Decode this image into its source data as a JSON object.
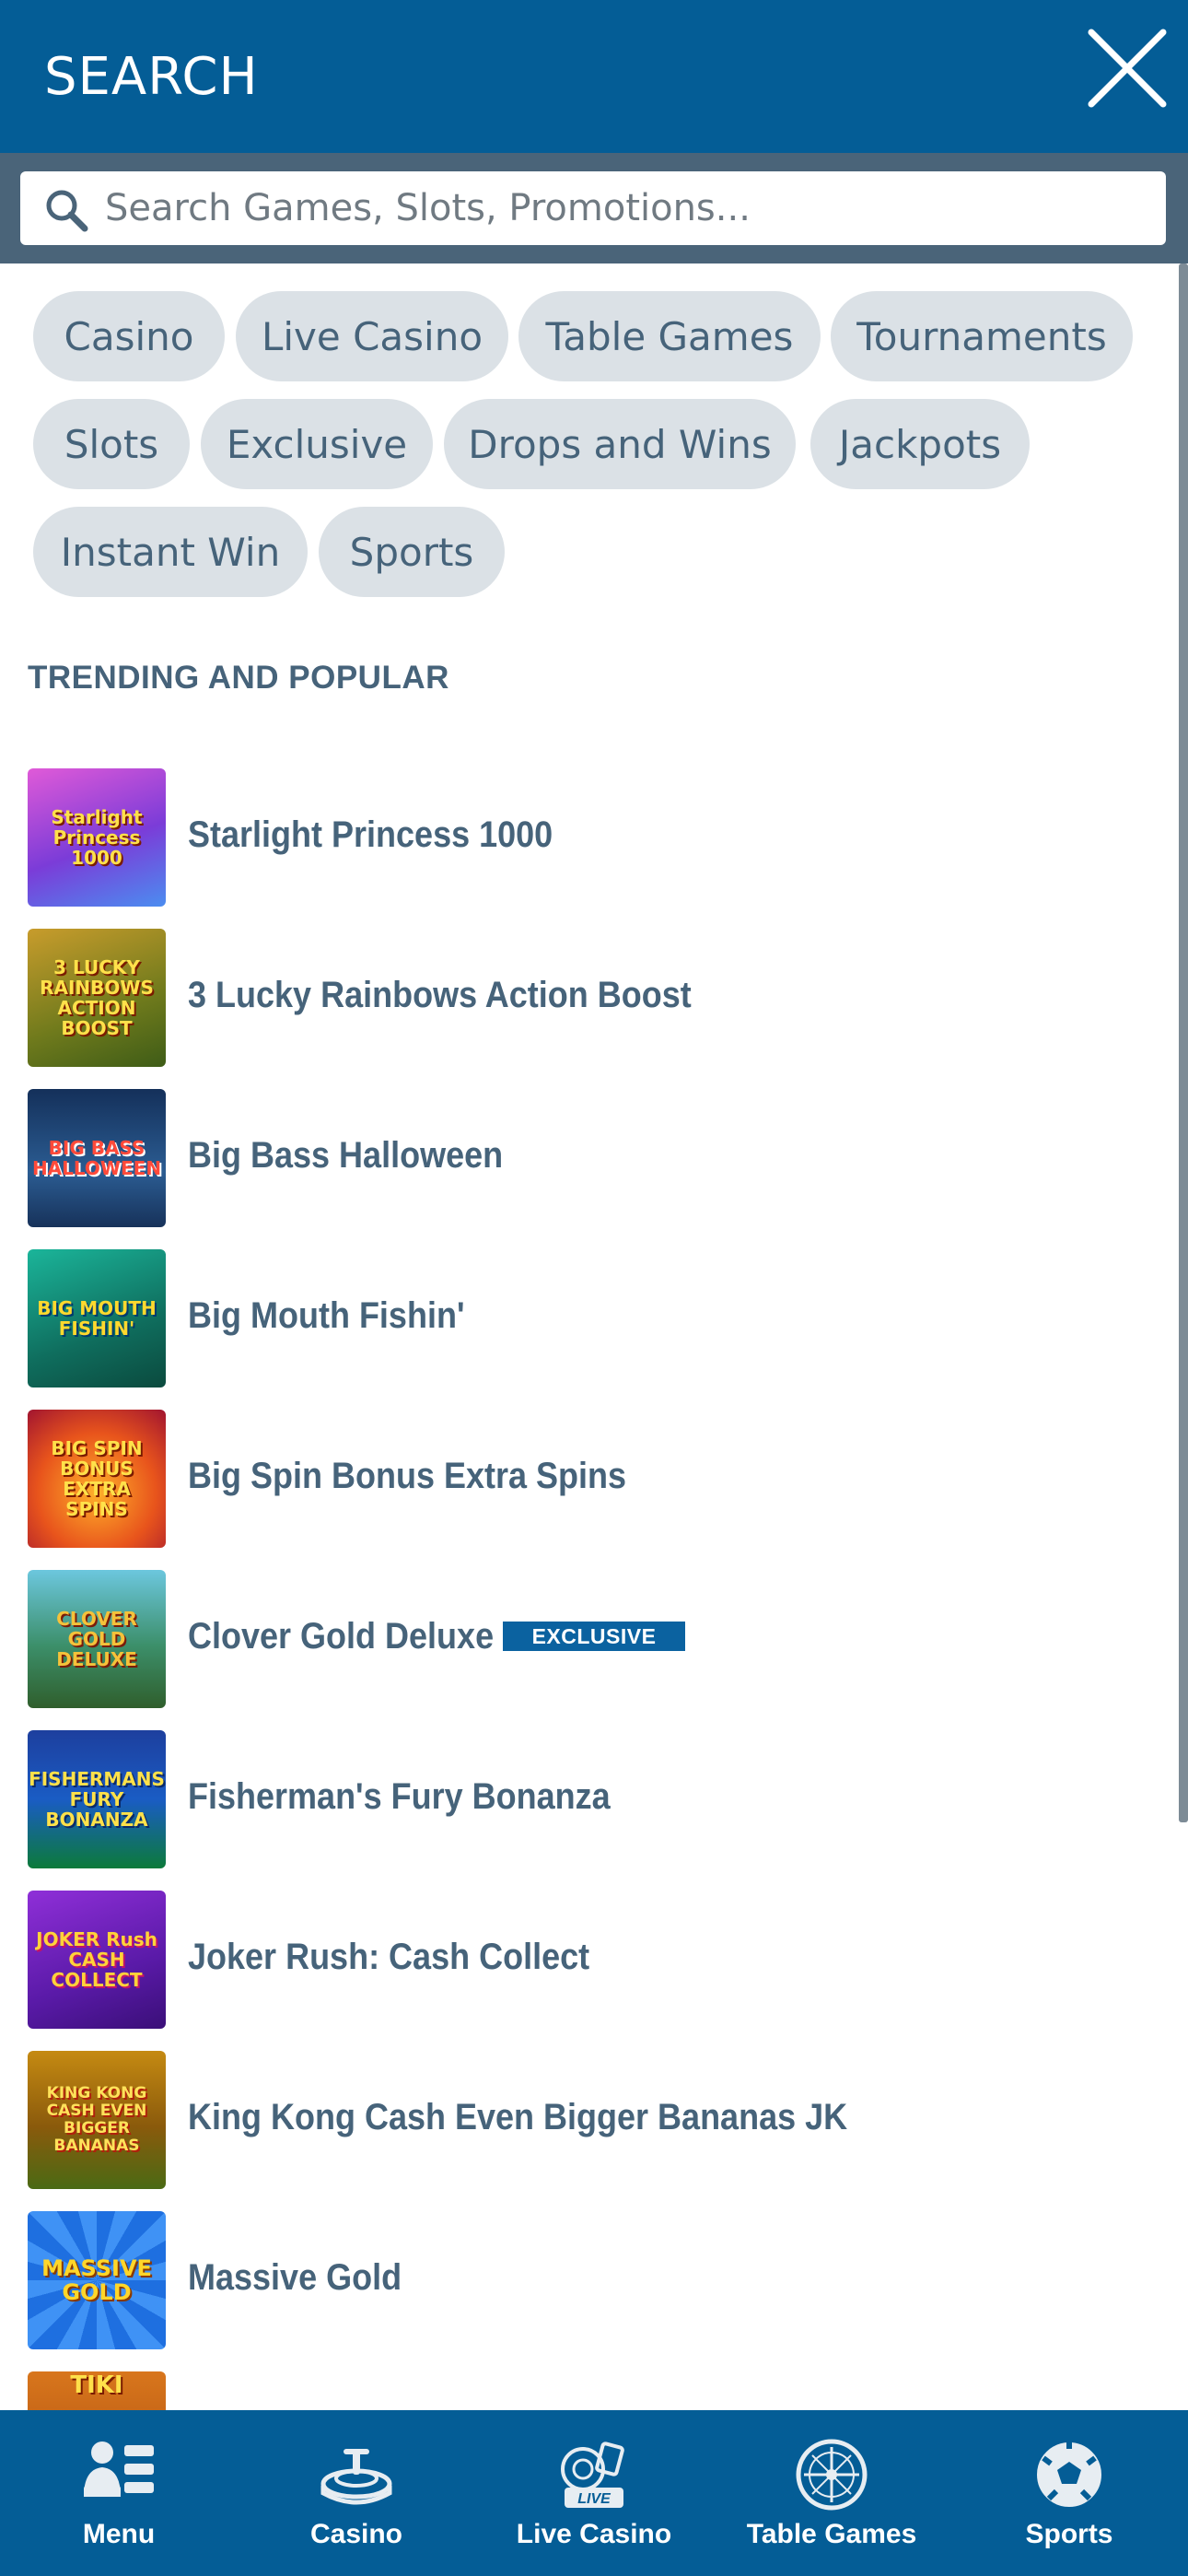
{
  "header": {
    "title": "SEARCH",
    "close_icon": "close-icon"
  },
  "search": {
    "placeholder": "Search Games, Slots, Promotions...",
    "value": ""
  },
  "categories": [
    "Casino",
    "Live Casino",
    "Table Games",
    "Tournaments",
    "Slots",
    "Exclusive",
    "Drops and Wins",
    "Jackpots",
    "Instant Win",
    "Sports"
  ],
  "trending": {
    "title": "TRENDING AND POPULAR",
    "games": [
      {
        "name": "Starlight Princess 1000",
        "thumb_text": "Starlight Princess 1000",
        "badge": ""
      },
      {
        "name": "3 Lucky Rainbows Action Boost",
        "thumb_text": "3 LUCKY RAINBOWS ACTION BOOST",
        "badge": ""
      },
      {
        "name": "Big Bass Halloween",
        "thumb_text": "BIG BASS HALLOWEEN",
        "badge": ""
      },
      {
        "name": "Big Mouth Fishin'",
        "thumb_text": "BIG MOUTH FISHIN'",
        "badge": ""
      },
      {
        "name": "Big Spin Bonus Extra Spins",
        "thumb_text": "BIG SPIN BONUS EXTRA SPINS",
        "badge": ""
      },
      {
        "name": "Clover Gold Deluxe",
        "thumb_text": "CLOVER GOLD DELUXE",
        "badge": "EXCLUSIVE"
      },
      {
        "name": "Fisherman's Fury Bonanza",
        "thumb_text": "FISHERMANS FURY BONANZA",
        "badge": ""
      },
      {
        "name": "Joker Rush: Cash Collect",
        "thumb_text": "JOKER Rush CASH COLLECT",
        "badge": ""
      },
      {
        "name": "King Kong Cash Even Bigger Bananas JK",
        "thumb_text": "KING KONG CASH EVEN BIGGER BANANAS",
        "badge": ""
      },
      {
        "name": "Massive Gold",
        "thumb_text": "MASSIVE GOLD",
        "badge": ""
      },
      {
        "name": "",
        "thumb_text": "TIKI",
        "badge": ""
      }
    ]
  },
  "bottom_nav": [
    {
      "label": "Menu",
      "icon": "menu-icon"
    },
    {
      "label": "Casino",
      "icon": "casino-icon"
    },
    {
      "label": "Live Casino",
      "icon": "live-casino-icon",
      "icon_text": "LIVE"
    },
    {
      "label": "Table Games",
      "icon": "table-games-icon"
    },
    {
      "label": "Sports",
      "icon": "sports-icon"
    }
  ],
  "colors": {
    "header": "#045d96",
    "search_band": "#4a6479",
    "chip_bg": "#dbe1e6",
    "text": "#46637a",
    "badge": "#0b62a0"
  }
}
